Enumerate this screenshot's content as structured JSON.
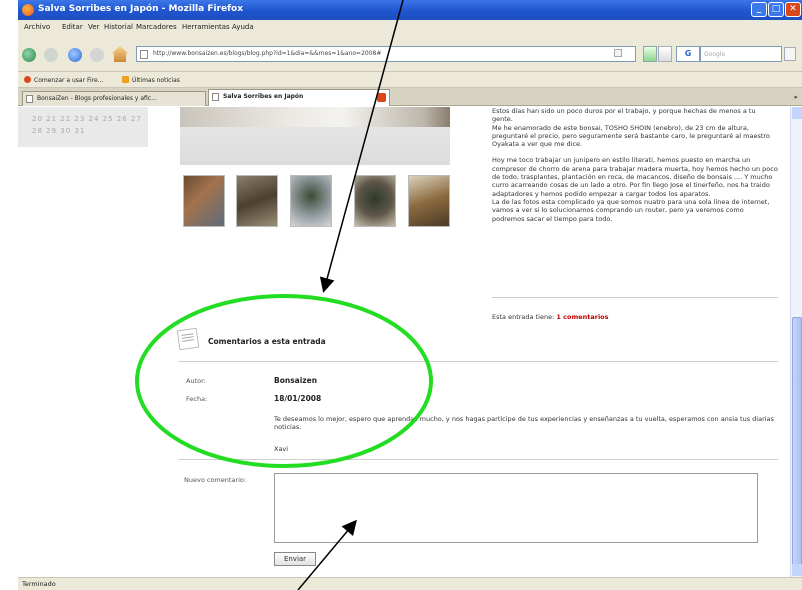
{
  "window": {
    "title": "Salva Sorribes en Japón - Mozilla Firefox"
  },
  "menubar": {
    "items": [
      "Archivo",
      "Editar",
      "Ver",
      "Historial",
      "Marcadores",
      "Herramientas",
      "Ayuda"
    ]
  },
  "navbar": {
    "url": "http://www.bonsaizen.es/blogs/blog.php?id=1&dia=&&mes=1&ano=2008#",
    "search_engine": "G",
    "search_placeholder": "Google"
  },
  "bookmarks": {
    "items": [
      {
        "label": "Comenzar a usar Fire...",
        "icon": "firefox-icon",
        "color": "#d8481c"
      },
      {
        "label": "Últimas noticias",
        "icon": "rss-icon",
        "color": "#f0a020"
      }
    ]
  },
  "tabs": [
    {
      "label": "BonsaiZen - Blogs profesionales y afic..."
    },
    {
      "label": "Salva Sorribes en Japón"
    }
  ],
  "calendar": {
    "rows": [
      "20  21  22  23  24  25  26  27",
      "28  29  30  31"
    ]
  },
  "post": {
    "paragraphs": [
      "Estos días han sido un poco duros por el trabajo, y porque hechas de menos a tu gente.\nMe he enamorado de este bonsai, TOSHO SHOIN (enebro), de 23 cm de altura, preguntaré el precio, pero seguramente será bastante caro, le preguntaré al maestro Oyakata a ver que me dice.",
      "Hoy me toco trabajar un junipero en estilo literati, hemos puesto en marcha un compresor de chorro de arena para trabajar madera muerta, hoy hemos hecho un poco de todo, trasplantes, plantación en roca, de macancos, diseño de bonsais .... Y mucho curro acarreando cosas de un lado a otro. Por fin llego Jose el tinerfeño, nos ha traido adaptadores y hemos podido empezar a cargar todos los aparatos.\nLa de las fotos esta complicado ya que somos nuatro para una sola línea de internet, vamos a ver si lo solucionamos comprando un router, pero ya veremos como podremos sacar el tiempo para todo."
    ],
    "entry_count_text": "Esta entrada tiene:",
    "entry_count_link": "1 comentarios"
  },
  "comments": {
    "title": "Comentarios a esta entrada",
    "author_label": "Autor:",
    "author_value": "Bonsaizen",
    "date_label": "Fecha:",
    "date_value": "18/01/2008",
    "body": "Te deseamos lo mejor, espero que aprendas mucho, y nos hagas partícipe de tus experiencias y enseñanzas a tu vuelta, esperamos con ansia tus diarias noticias.",
    "signature": "Xavi",
    "new_comment_label": "Nuevo comentario:",
    "send_label": "Enviar"
  },
  "status": {
    "text": "Terminado"
  },
  "colors": {
    "annotation_circle": "#22dd22",
    "titlebar": "#1f55cf",
    "link": "#bb0000"
  }
}
